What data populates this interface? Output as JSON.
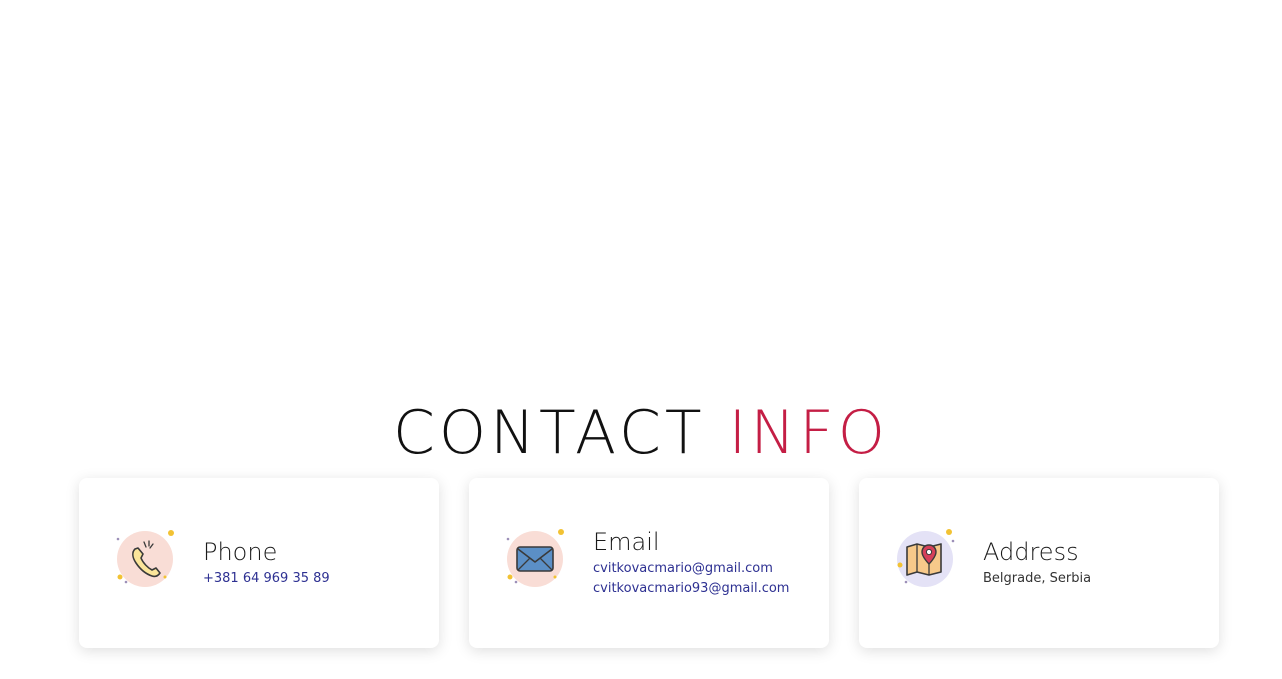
{
  "heading": {
    "part1": "CONTACT",
    "part2": "INFO"
  },
  "colors": {
    "accent": "#c41e45",
    "link": "#2e3192",
    "phone_icon_bg": "#f9ddd6",
    "email_icon_bg": "#f9ddd6",
    "address_icon_bg": "#e4e2f6"
  },
  "cards": [
    {
      "icon": "phone-icon",
      "title": "Phone",
      "lines": [
        "+381 64 969 35 89"
      ]
    },
    {
      "icon": "envelope-icon",
      "title": "Email",
      "lines": [
        "cvitkovacmario@gmail.com",
        "cvitkovacmario93@gmail.com"
      ]
    },
    {
      "icon": "map-pin-icon",
      "title": "Address",
      "lines": [
        "Belgrade, Serbia"
      ]
    }
  ]
}
